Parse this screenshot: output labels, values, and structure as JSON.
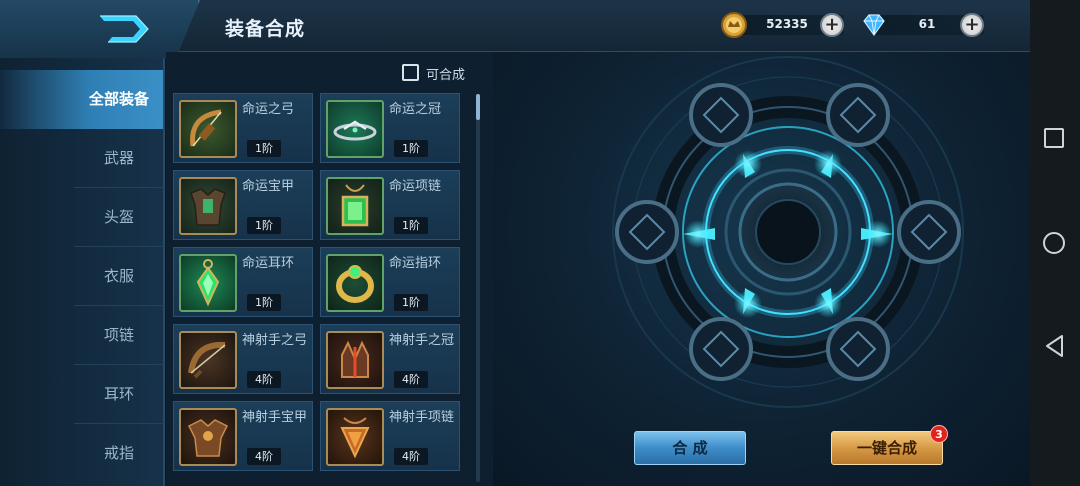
{
  "header": {
    "title": "装备合成"
  },
  "currency": {
    "gold": {
      "icon": "gold-coin-icon",
      "value": "52335"
    },
    "diamond": {
      "icon": "diamond-icon",
      "value": "61"
    },
    "plus_label": "+"
  },
  "sidebar": {
    "items": [
      {
        "label": "全部装备",
        "active": true
      },
      {
        "label": "武器"
      },
      {
        "label": "头盔"
      },
      {
        "label": "衣服"
      },
      {
        "label": "项链"
      },
      {
        "label": "耳环"
      },
      {
        "label": "戒指"
      }
    ]
  },
  "filter": {
    "label": "可合成",
    "checked": false
  },
  "items": [
    {
      "name": "命运之弓",
      "tier": "1阶",
      "icon": "bow-icon"
    },
    {
      "name": "命运之冠",
      "tier": "1阶",
      "icon": "crown-icon"
    },
    {
      "name": "命运宝甲",
      "tier": "1阶",
      "icon": "armor-icon"
    },
    {
      "name": "命运项链",
      "tier": "1阶",
      "icon": "necklace-icon"
    },
    {
      "name": "命运耳环",
      "tier": "1阶",
      "icon": "earring-icon"
    },
    {
      "name": "命运指环",
      "tier": "1阶",
      "icon": "ring-icon"
    },
    {
      "name": "神射手之弓",
      "tier": "4阶",
      "icon": "bow-icon"
    },
    {
      "name": "神射手之冠",
      "tier": "4阶",
      "icon": "crown-icon"
    },
    {
      "name": "神射手宝甲",
      "tier": "4阶",
      "icon": "armor-icon"
    },
    {
      "name": "神射手项链",
      "tier": "4阶",
      "icon": "necklace-icon"
    }
  ],
  "craft": {
    "craft_label": "合 成",
    "one_click_label": "一键合成",
    "one_click_badge": "3",
    "slot_icon": "empty-slot-icon"
  },
  "colors": {
    "accent_blue": "#3d8cc8",
    "accent_gold": "#d69a46",
    "badge_red": "#e0241b",
    "cyan_glow": "#2fe6ff"
  }
}
